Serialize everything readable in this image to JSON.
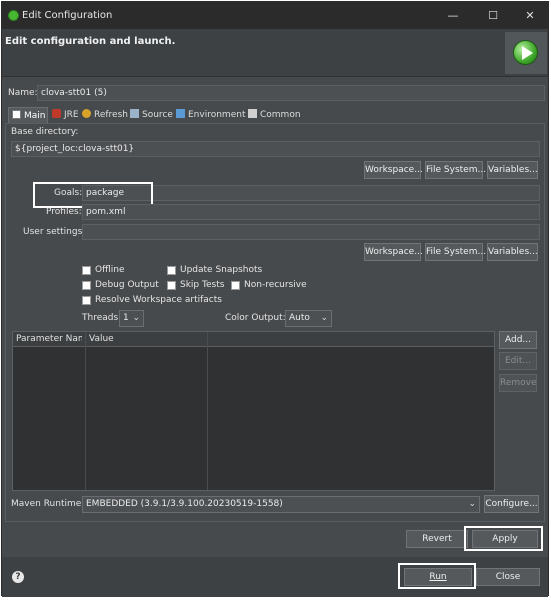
{
  "window": {
    "title": "Edit Configuration",
    "minimize": "—",
    "maximize": "☐",
    "close": "✕"
  },
  "header": {
    "title": "Edit configuration and launch."
  },
  "name": {
    "label": "Name:",
    "value": "clova-stt01 (5)"
  },
  "tabs": [
    {
      "label": "Main",
      "icon": "main-tab-icon"
    },
    {
      "label": "JRE",
      "icon": "jre-icon"
    },
    {
      "label": "Refresh",
      "icon": "refresh-icon"
    },
    {
      "label": "Source",
      "icon": "source-icon"
    },
    {
      "label": "Environment",
      "icon": "environment-icon"
    },
    {
      "label": "Common",
      "icon": "common-icon"
    }
  ],
  "main": {
    "base_dir_label": "Base directory:",
    "base_dir_value": "${project_loc:clova-stt01}",
    "workspace_btn": "Workspace...",
    "filesystem_btn": "File System...",
    "variables_btn": "Variables...",
    "goals_label": "Goals:",
    "goals_value": "package",
    "profiles_label": "Profiles:",
    "profiles_value": "pom.xml",
    "user_settings_label": "User settings:",
    "user_settings_value": "",
    "workspace_btn2": "Workspace...",
    "filesystem_btn2": "File System...",
    "variables_btn2": "Variables...",
    "offline": "Offline",
    "update_snapshots": "Update Snapshots",
    "debug_output": "Debug Output",
    "skip_tests": "Skip Tests",
    "non_recursive": "Non-recursive",
    "resolve_workspace": "Resolve Workspace artifacts",
    "threads_label": "Threads:",
    "threads_value": "1",
    "color_output_label": "Color Output:",
    "color_output_value": "Auto",
    "param_col_name": "Parameter Name",
    "param_col_value": "Value",
    "add_btn": "Add...",
    "edit_btn": "Edit...",
    "remove_btn": "Remove",
    "maven_runtime_label": "Maven Runtime:",
    "maven_runtime_value": "EMBEDDED (3.9.1/3.9.100.20230519-1558)",
    "configure_btn": "Configure..."
  },
  "actions": {
    "revert": "Revert",
    "apply": "Apply",
    "run": "Run",
    "close": "Close"
  },
  "help_icon": "?"
}
